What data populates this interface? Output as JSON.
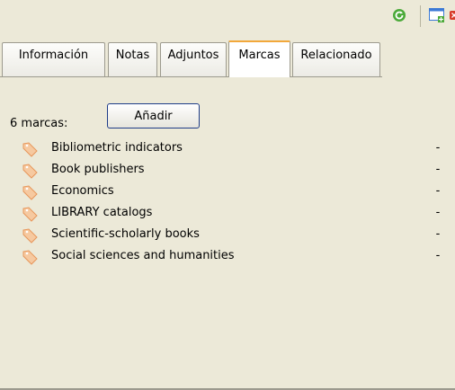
{
  "toolbar": {
    "icons": [
      "refresh-icon",
      "new-window-icon",
      "close-icon"
    ],
    "colors": {
      "refresh": "#4caa3a",
      "new_window": "#3c7ad6",
      "close": "#d83a2a"
    }
  },
  "tabs": [
    {
      "label": "Información",
      "selected": false
    },
    {
      "label": "Notas",
      "selected": false
    },
    {
      "label": "Adjuntos",
      "selected": false
    },
    {
      "label": "Marcas",
      "selected": true
    },
    {
      "label": "Relacionado",
      "selected": false
    }
  ],
  "panel": {
    "count_label": "6 marcas:",
    "add_button_label": "Añadir",
    "tags": [
      {
        "label": "Bibliometric indicators",
        "remove": "-"
      },
      {
        "label": "Book publishers",
        "remove": "-"
      },
      {
        "label": "Economics",
        "remove": "-"
      },
      {
        "label": "LIBRARY catalogs",
        "remove": "-"
      },
      {
        "label": "Scientific-scholarly books",
        "remove": "-"
      },
      {
        "label": "Social sciences and humanities",
        "remove": "-"
      }
    ],
    "tag_icon": "tag-icon",
    "accent": "#f2a83b"
  }
}
